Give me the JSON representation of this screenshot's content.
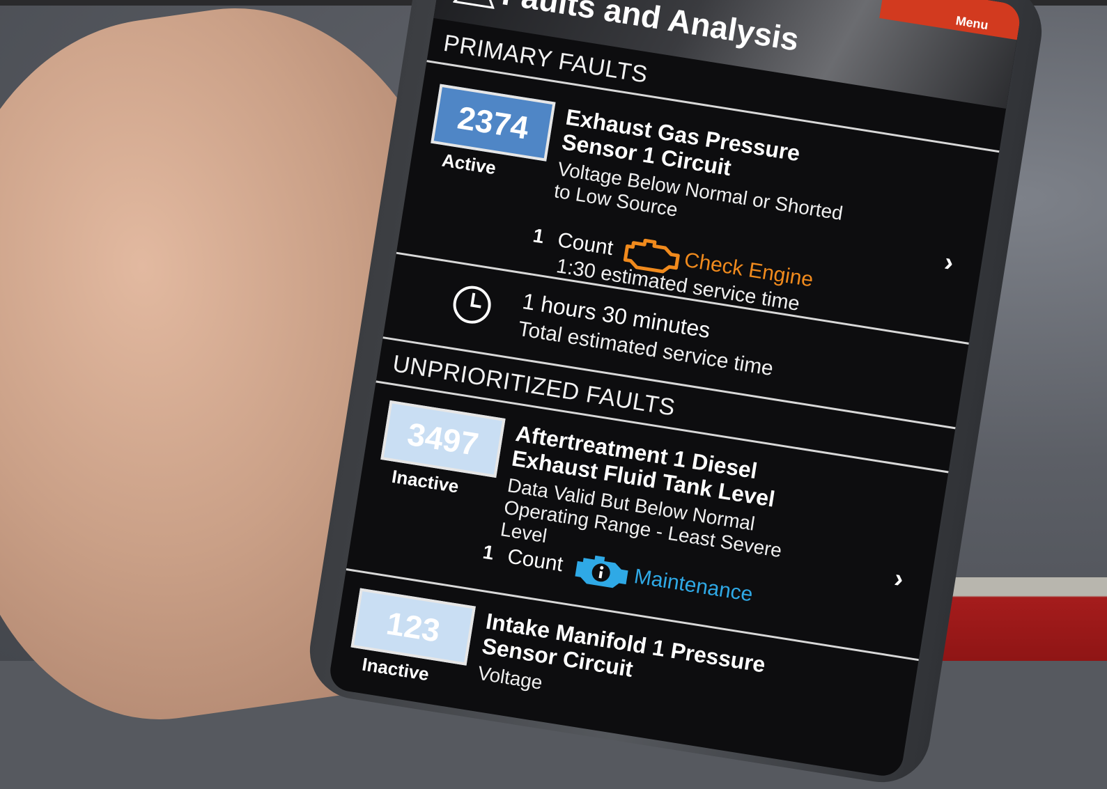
{
  "app": {
    "menu_label": "Menu",
    "title": "Faults and Analysis"
  },
  "sections": {
    "primary_heading": "PRIMARY FAULTS",
    "unprioritized_heading": "UNPRIORITIZED FAULTS"
  },
  "primary_faults": [
    {
      "code": "2374",
      "status": "Active",
      "title": "Exhaust Gas Pressure Sensor 1 Circuit",
      "description": "Voltage Below Normal or Shorted to Low Source",
      "count_number": "1",
      "count_label": "Count",
      "severity": "Check Engine",
      "severity_icon": "check-engine-icon",
      "service_time": "1:30 estimated service time"
    }
  ],
  "total": {
    "value": "1 hours 30 minutes",
    "label": "Total estimated service time"
  },
  "unprioritized_faults": [
    {
      "code": "3497",
      "status": "Inactive",
      "title": "Aftertreatment 1 Diesel Exhaust Fluid Tank Level",
      "description": "Data Valid But Below Normal Operating Range - Least Severe Level",
      "count_number": "1",
      "count_label": "Count",
      "severity": "Maintenance",
      "severity_icon": "maintenance-icon"
    },
    {
      "code": "123",
      "status": "Inactive",
      "title": "Intake Manifold 1 Pressure Sensor Circuit",
      "description": "Voltage"
    }
  ],
  "colors": {
    "menu_bar": "#d23a1f",
    "active_code_bg": "#4f86c6",
    "inactive_code_bg": "#c9def3",
    "check_engine": "#f08a1d",
    "maintenance": "#2fa9e6"
  }
}
